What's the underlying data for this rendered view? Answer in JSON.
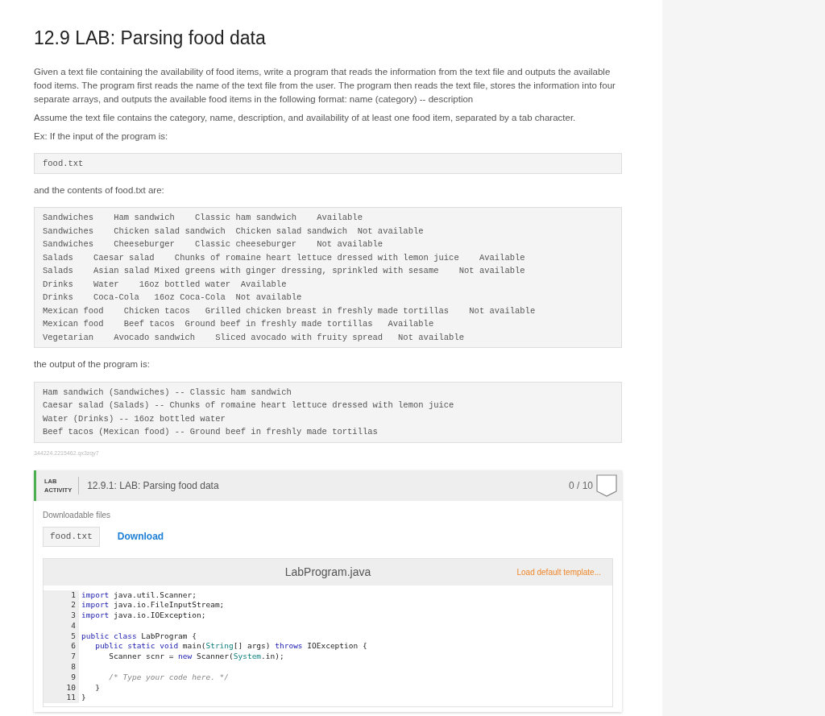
{
  "title": "12.9 LAB: Parsing food data",
  "paragraphs": [
    "Given a text file containing the availability of food items, write a program that reads the information from the text file and outputs the available food items. The program first reads the name of the text file from the user. The program then reads the text file, stores the information into four separate arrays, and outputs the available food items in the following format: name (category) -- description",
    "Assume the text file contains the category, name, description, and availability of at least one food item, separated by a tab character.",
    "Ex: If the input of the program is:"
  ],
  "input_block": [
    "food.txt"
  ],
  "contents_label": "and the contents of food.txt are:",
  "contents_block": [
    "Sandwiches    Ham sandwich    Classic ham sandwich    Available",
    "Sandwiches    Chicken salad sandwich  Chicken salad sandwich  Not available",
    "Sandwiches    Cheeseburger    Classic cheeseburger    Not available",
    "Salads    Caesar salad    Chunks of romaine heart lettuce dressed with lemon juice    Available",
    "Salads    Asian salad Mixed greens with ginger dressing, sprinkled with sesame    Not available",
    "Drinks    Water    16oz bottled water  Available",
    "Drinks    Coca-Cola   16oz Coca-Cola  Not available",
    "Mexican food    Chicken tacos   Grilled chicken breast in freshly made tortillas    Not available",
    "Mexican food    Beef tacos  Ground beef in freshly made tortillas   Available",
    "Vegetarian    Avocado sandwich    Sliced avocado with fruity spread   Not available"
  ],
  "output_label": "the output of the program is:",
  "output_block": [
    "Ham sandwich (Sandwiches) -- Classic ham sandwich",
    "Caesar salad (Salads) -- Chunks of romaine heart lettuce dressed with lemon juice",
    "Water (Drinks) -- 16oz bottled water",
    "Beef tacos (Mexican food) -- Ground beef in freshly made tortillas"
  ],
  "tracking_id": "344224.2215462.qx3zqy7",
  "lab_activity": {
    "tag_lines": [
      "LAB",
      "ACTIVITY"
    ],
    "title": "12.9.1: LAB: Parsing food data",
    "score": "0 / 10",
    "downloads_label": "Downloadable files",
    "file": "food.txt",
    "download_link": "Download",
    "editor": {
      "filename": "LabProgram.java",
      "template_link": "Load default template...",
      "lines": [
        {
          "number": "1",
          "tokens": [
            {
              "kind": "keyword",
              "text": "import"
            },
            {
              "kind": "plain",
              "text": " java.util.Scanner;"
            }
          ]
        },
        {
          "number": "2",
          "tokens": [
            {
              "kind": "keyword",
              "text": "import"
            },
            {
              "kind": "plain",
              "text": " java.io.FileInputStream;"
            }
          ]
        },
        {
          "number": "3",
          "tokens": [
            {
              "kind": "keyword",
              "text": "import"
            },
            {
              "kind": "plain",
              "text": " java.io.IOException;"
            }
          ]
        },
        {
          "number": "4"
        },
        {
          "number": "5",
          "tokens": [
            {
              "kind": "keyword",
              "text": "public class"
            },
            {
              "kind": "plain",
              "text": " LabProgram {"
            }
          ]
        },
        {
          "number": "6",
          "tokens": [
            {
              "kind": "keyword",
              "text": "   public static void"
            },
            {
              "kind": "plain",
              "text": " main("
            },
            {
              "kind": "type",
              "text": "String"
            },
            {
              "kind": "plain",
              "text": "[] args) "
            },
            {
              "kind": "keyword",
              "text": "throws"
            },
            {
              "kind": "plain",
              "text": " IOException {"
            }
          ]
        },
        {
          "number": "7",
          "tokens": [
            {
              "kind": "plain",
              "text": "      Scanner scnr = "
            },
            {
              "kind": "keyword",
              "text": "new"
            },
            {
              "kind": "plain",
              "text": " Scanner("
            },
            {
              "kind": "type",
              "text": "System"
            },
            {
              "kind": "plain",
              "text": ".in);"
            }
          ]
        },
        {
          "number": "8"
        },
        {
          "number": "9",
          "tokens": [
            {
              "kind": "comment",
              "text": "      /* Type your code here. */"
            }
          ]
        },
        {
          "number": "10",
          "tokens": [
            {
              "kind": "plain",
              "text": "   }"
            }
          ]
        },
        {
          "number": "11",
          "tokens": [
            {
              "kind": "plain",
              "text": "}"
            }
          ]
        }
      ]
    }
  }
}
